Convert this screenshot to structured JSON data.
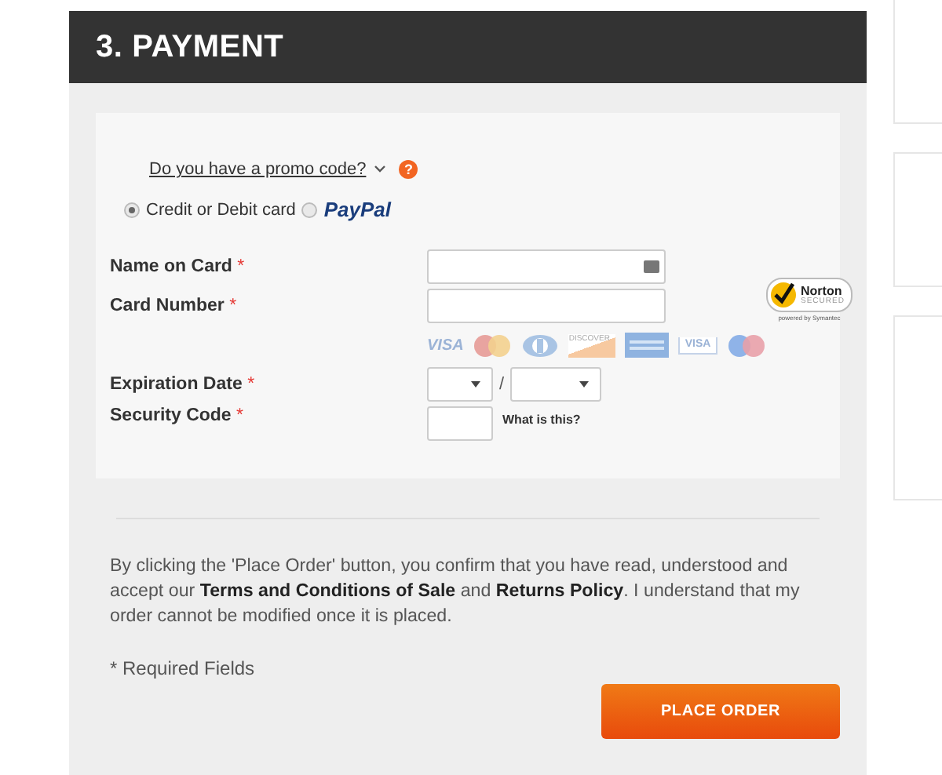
{
  "section": {
    "title": "3. PAYMENT"
  },
  "promo": {
    "link": "Do you have a promo code?",
    "help": "?"
  },
  "payment_methods": [
    {
      "kind": "card",
      "label": "Credit or Debit card",
      "selected": true
    },
    {
      "kind": "paypal",
      "label": "PayPal",
      "selected": false
    }
  ],
  "fields": [
    {
      "kind": "text",
      "label": "Name on Card",
      "required": "*",
      "autofill_icon": true
    },
    {
      "kind": "text",
      "label": "Card Number",
      "required": "*",
      "autofill_icon": false
    },
    {
      "kind": "logos"
    },
    {
      "kind": "expiry",
      "label": "Expiration Date",
      "required": "*",
      "separator": "/"
    },
    {
      "kind": "security",
      "label": "Security Code",
      "required": "*",
      "hint": "What is this?"
    }
  ],
  "card_logos": [
    {
      "kind": "visa",
      "label": "VISA"
    },
    {
      "kind": "mastercard"
    },
    {
      "kind": "diners"
    },
    {
      "kind": "discover",
      "label": "DISCOVER"
    },
    {
      "kind": "amex"
    },
    {
      "kind": "visa_electron",
      "label": "VISA"
    },
    {
      "kind": "maestro"
    }
  ],
  "norton": {
    "name": "Norton",
    "badge": "SECURED",
    "note": "powered by Symantec"
  },
  "notice": "By clicking the 'Place Order' button, you confirm that you have read, understood and accept our **Terms and Conditions of Sale** and **Returns Policy**. I understand that my order cannot be modified once it is placed.",
  "required_note": "* Required Fields",
  "button": "PLACE ORDER"
}
